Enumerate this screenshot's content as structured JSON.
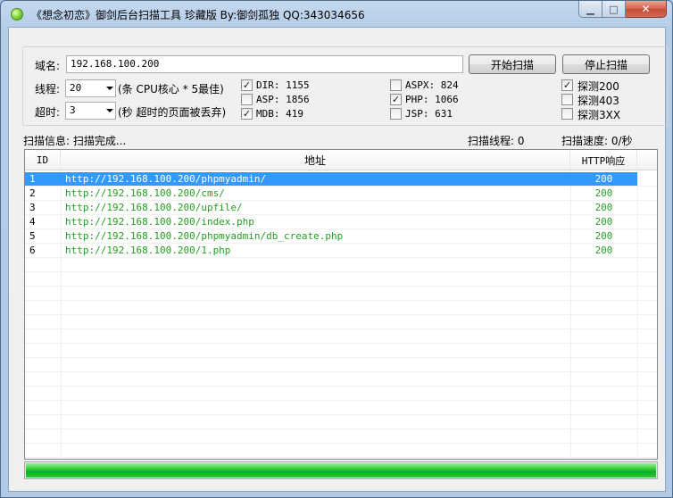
{
  "window": {
    "title": "《想念初恋》御剑后台扫描工具 珍藏版 By:御剑孤独 QQ:343034656"
  },
  "form": {
    "domain_label": "域名:",
    "domain_value": "192.168.100.200",
    "threads_label": "线程:",
    "threads_value": "20",
    "threads_hint": "(条 CPU核心 * 5最佳)",
    "timeout_label": "超时:",
    "timeout_value": "3",
    "timeout_hint": "(秒 超时的页面被丢弃)",
    "start_button": "开始扫描",
    "stop_button": "停止扫描"
  },
  "dictionaries": [
    {
      "label": "DIR: 1155",
      "checked": true
    },
    {
      "label": "ASP: 1856",
      "checked": false
    },
    {
      "label": "MDB: 419",
      "checked": true
    },
    {
      "label": "ASPX: 824",
      "checked": false
    },
    {
      "label": "PHP: 1066",
      "checked": true
    },
    {
      "label": "JSP: 631",
      "checked": false
    }
  ],
  "probes": [
    {
      "label": "探测200",
      "checked": true
    },
    {
      "label": "探测403",
      "checked": false
    },
    {
      "label": "探测3XX",
      "checked": false
    }
  ],
  "status": {
    "info": "扫描信息: 扫描完成...",
    "threads": "扫描线程: 0",
    "speed": "扫描速度: 0/秒"
  },
  "table": {
    "columns": [
      "ID",
      "地址",
      "HTTP响应"
    ],
    "rows": [
      {
        "id": "1",
        "url": "http://192.168.100.200/phpmyadmin/",
        "http": "200",
        "selected": true
      },
      {
        "id": "2",
        "url": "http://192.168.100.200/cms/",
        "http": "200"
      },
      {
        "id": "3",
        "url": "http://192.168.100.200/upfile/",
        "http": "200"
      },
      {
        "id": "4",
        "url": "http://192.168.100.200/index.php",
        "http": "200"
      },
      {
        "id": "5",
        "url": "http://192.168.100.200/phpmyadmin/db_create.php",
        "http": "200"
      },
      {
        "id": "6",
        "url": "http://192.168.100.200/1.php",
        "http": "200"
      }
    ]
  },
  "progress": {
    "value_percent": 100
  },
  "colors": {
    "url_green": "#22a022",
    "selection": "#3399ff",
    "progress_green": "#06b025"
  }
}
